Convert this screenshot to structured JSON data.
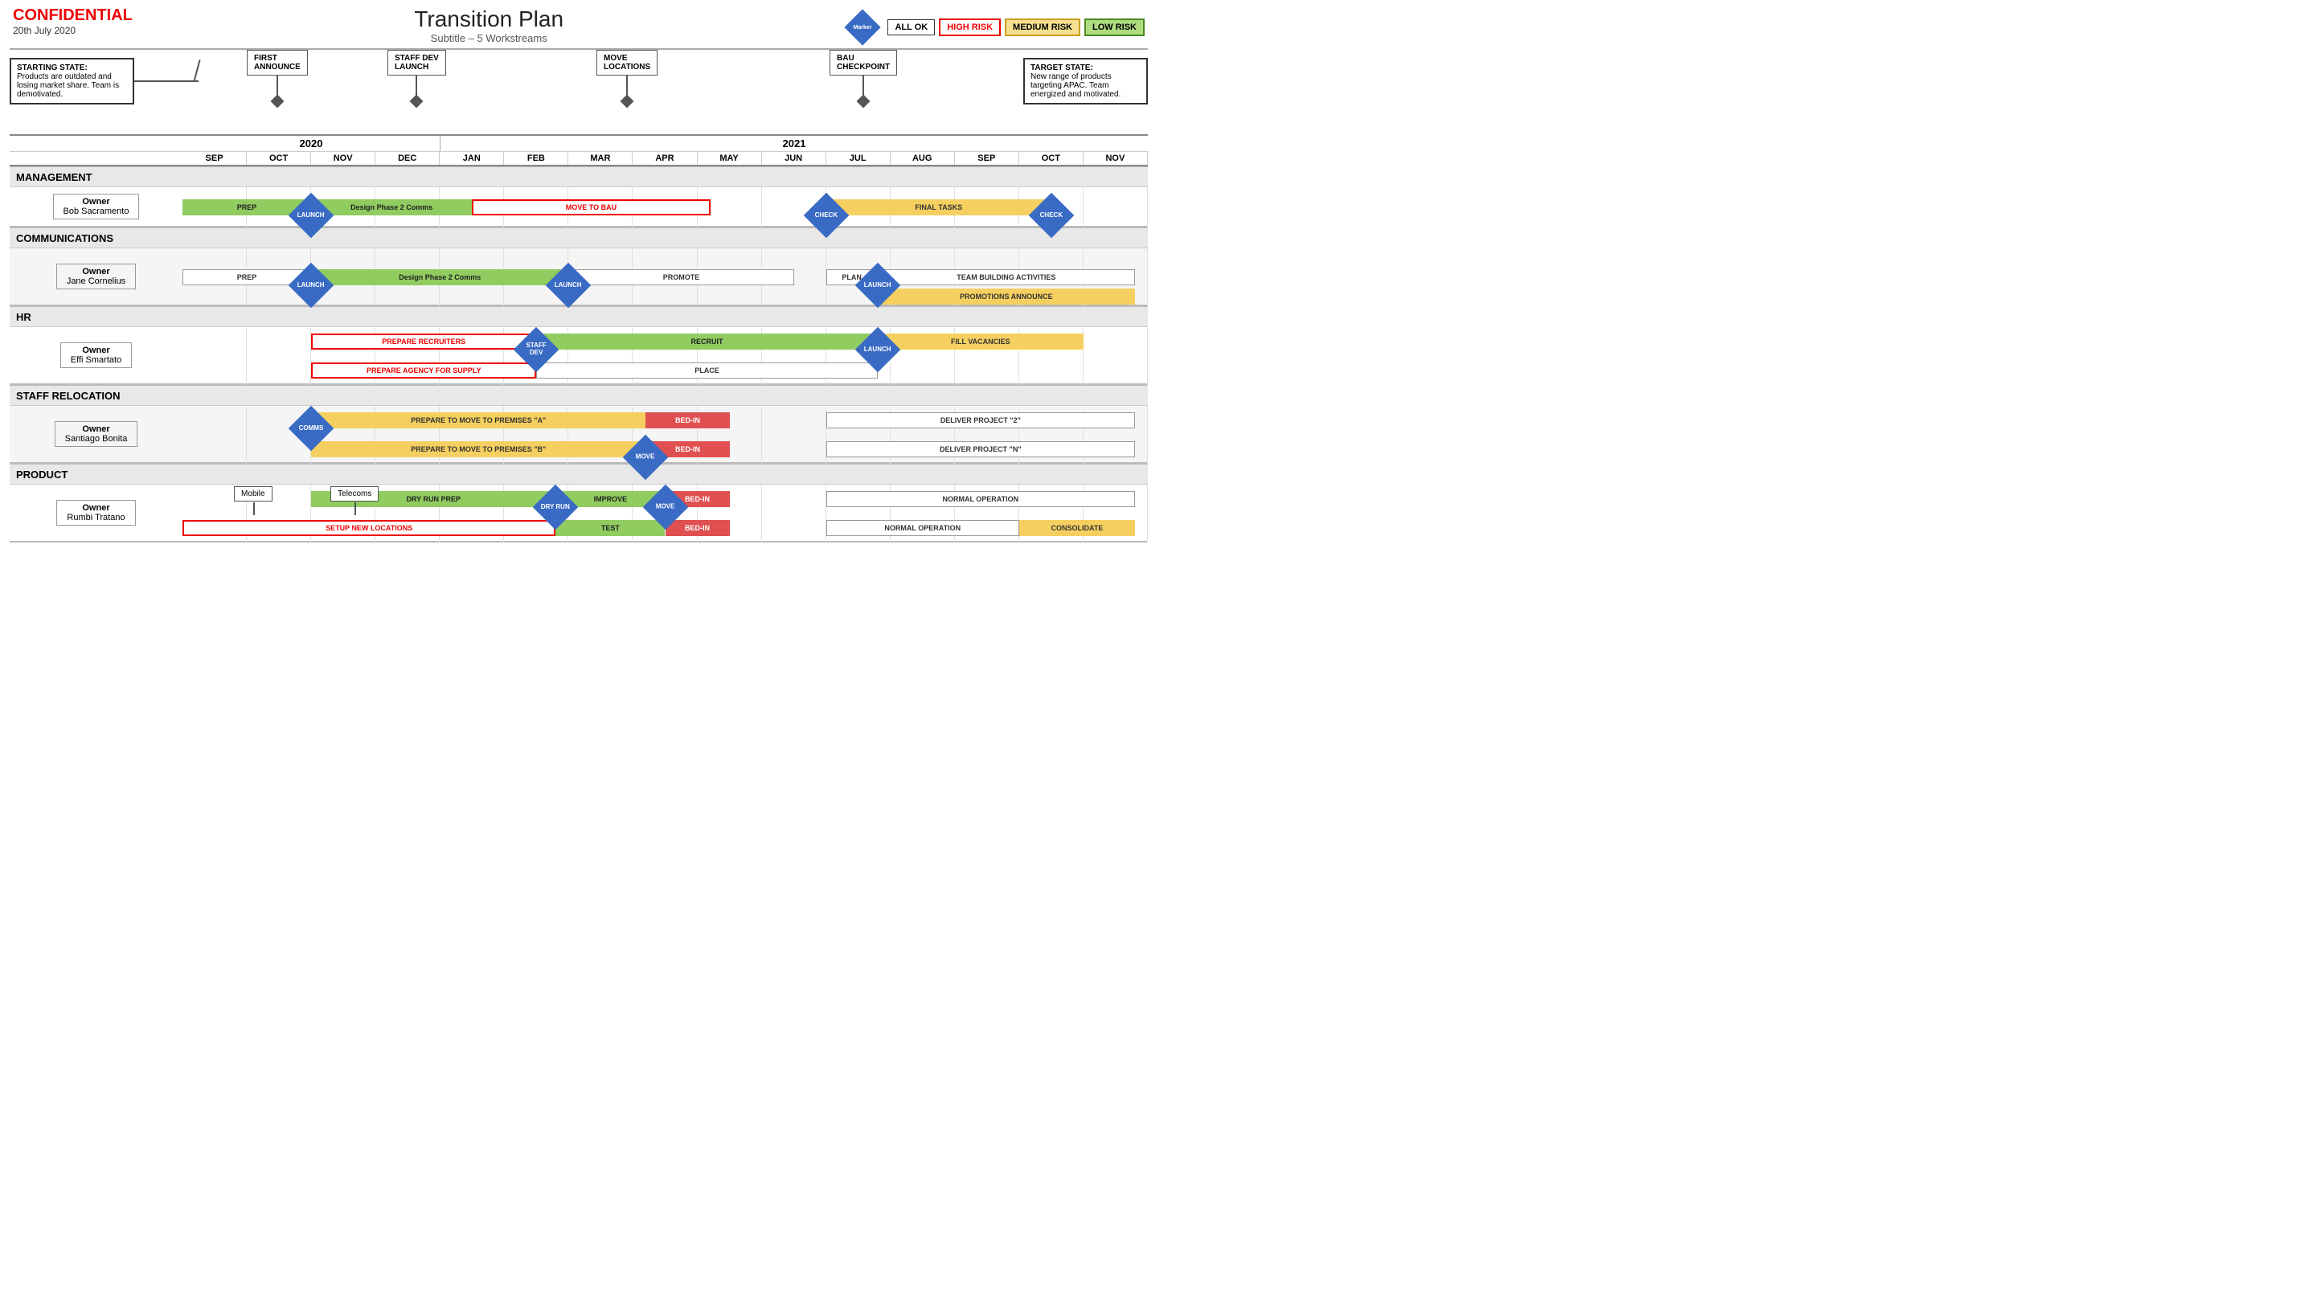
{
  "header": {
    "confidential": "CONFIDENTIAL",
    "date": "20th July 2020",
    "title": "Transition Plan",
    "subtitle": "Subtitle – 5 Workstreams",
    "legend": {
      "marker": "Marker",
      "allok": "ALL OK",
      "high": "HIGH RISK",
      "medium": "MEDIUM RISK",
      "low": "LOW RISK"
    }
  },
  "milestones": [
    {
      "id": "first-announce",
      "label": "FIRST ANNOUNCE",
      "col": 2.5
    },
    {
      "id": "staff-dev-launch",
      "label": "STAFF DEV LAUNCH",
      "col": 4.2
    },
    {
      "id": "move-locations",
      "label": "MOVE LOCATIONS",
      "col": 7.2
    },
    {
      "id": "bau-checkpoint",
      "label": "BAU CHECKPOINT",
      "col": 10.2
    }
  ],
  "starting_state": {
    "title": "STARTING STATE:",
    "body": "Products are outdated and losing market share. Team is demotivated."
  },
  "target_state": {
    "title": "TARGET STATE:",
    "body": "New range of products targeting APAC. Team energized and motivated."
  },
  "years": [
    {
      "label": "2020",
      "span": 4
    },
    {
      "label": "2021",
      "span": 11
    }
  ],
  "months": [
    "SEP",
    "OCT",
    "NOV",
    "DEC",
    "JAN",
    "FEB",
    "MAR",
    "APR",
    "MAY",
    "JUN",
    "JUL",
    "AUG",
    "SEP",
    "OCT",
    "NOV"
  ],
  "sections": [
    {
      "id": "management",
      "label": "MANAGEMENT",
      "owner": {
        "label": "Owner",
        "name": "Bob Sacramento"
      },
      "rows": [
        {
          "bars": [
            {
              "type": "green",
              "label": "PREP",
              "start": 0,
              "end": 2
            },
            {
              "type": "diamond",
              "label": "LAUNCH",
              "col": 2
            },
            {
              "type": "green",
              "label": "Design Phase 2 Comms",
              "start": 2,
              "end": 4.5
            },
            {
              "type": "red-outline",
              "label": "MOVE TO BAU",
              "start": 4.5,
              "end": 8.2
            },
            {
              "type": "diamond",
              "label": "CHECK",
              "col": 10
            },
            {
              "type": "yellow",
              "label": "FINAL TASKS",
              "start": 10,
              "end": 13.5
            },
            {
              "type": "diamond",
              "label": "CHECK",
              "col": 13.5
            }
          ]
        }
      ]
    },
    {
      "id": "communications",
      "label": "COMMUNICATIONS",
      "owner": {
        "label": "Owner",
        "name": "Jane Cornelius"
      },
      "rows": [
        {
          "bars": [
            {
              "type": "white",
              "label": "PREP",
              "start": 0,
              "end": 2
            },
            {
              "type": "diamond",
              "label": "LAUNCH",
              "col": 2
            },
            {
              "type": "green",
              "label": "Design Phase 2 Comms",
              "start": 2,
              "end": 6
            },
            {
              "type": "diamond",
              "label": "LAUNCH",
              "col": 6
            },
            {
              "type": "white",
              "label": "PROMOTE",
              "start": 6,
              "end": 9.5
            },
            {
              "type": "white",
              "label": "PLAN",
              "start": 10,
              "end": 10.8
            },
            {
              "type": "diamond",
              "label": "LAUNCH",
              "col": 10.8
            },
            {
              "type": "white",
              "label": "TEAM BUILDING ACTIVITIES",
              "start": 10.8,
              "end": 14.8
            },
            {
              "type": "yellow",
              "label": "PROMOTIONS ANNOUNCE",
              "start": 10.8,
              "end": 14.8,
              "row": 1
            }
          ]
        }
      ]
    },
    {
      "id": "hr",
      "label": "HR",
      "owner": {
        "label": "Owner",
        "name": "Effi Smartato"
      },
      "rows": [
        {
          "bars": [
            {
              "type": "red-outline",
              "label": "PREPARE RECRUITERS",
              "start": 2,
              "end": 5.5
            },
            {
              "type": "diamond",
              "label": "STAFF DEV",
              "col": 5.5
            },
            {
              "type": "green",
              "label": "RECRUIT",
              "start": 5.5,
              "end": 10.8
            },
            {
              "type": "diamond",
              "label": "LAUNCH",
              "col": 10.8
            },
            {
              "type": "yellow",
              "label": "FILL VACANCIES",
              "start": 10.8,
              "end": 14
            }
          ]
        },
        {
          "bars": [
            {
              "type": "red-outline",
              "label": "PREPARE AGENCY FOR SUPPLY",
              "start": 2,
              "end": 5.5
            },
            {
              "type": "white",
              "label": "PLACE",
              "start": 5.5,
              "end": 10.8
            }
          ]
        }
      ]
    },
    {
      "id": "staff-relocation",
      "label": "STAFF RELOCATION",
      "owner": {
        "label": "Owner",
        "name": "Santiago Bonita"
      },
      "rows": [
        {
          "bars": [
            {
              "type": "diamond",
              "label": "COMMS",
              "col": 2
            },
            {
              "type": "yellow",
              "label": "PREPARE TO MOVE TO PREMISES \"A\"",
              "start": 2,
              "end": 7.2
            },
            {
              "type": "red-fill",
              "label": "BED-IN",
              "start": 7.2,
              "end": 8.5
            },
            {
              "type": "white",
              "label": "DELIVER PROJECT \"2\"",
              "start": 10,
              "end": 14.8
            }
          ]
        },
        {
          "bars": [
            {
              "type": "diamond",
              "label": "MOVE",
              "col": 7.2
            },
            {
              "type": "yellow",
              "label": "PREPARE TO MOVE TO PREMISES \"B\"",
              "start": 2,
              "end": 7.2
            },
            {
              "type": "red-fill",
              "label": "BED-IN",
              "start": 7.2,
              "end": 8.5
            },
            {
              "type": "white",
              "label": "DELIVER PROJECT \"N\"",
              "start": 10,
              "end": 14.8
            }
          ]
        }
      ]
    },
    {
      "id": "product",
      "label": "PRODUCT",
      "owner": {
        "label": "Owner",
        "name": "Rumbi Tratano"
      },
      "rows": [
        {
          "bars": [
            {
              "type": "green",
              "label": "DRY RUN PREP",
              "start": 2,
              "end": 5.8
            },
            {
              "type": "diamond",
              "label": "DRY RUN",
              "col": 5.8
            },
            {
              "type": "green",
              "label": "IMPROVE",
              "start": 5.8,
              "end": 7.5
            },
            {
              "type": "diamond",
              "label": "MOVE",
              "col": 7.5
            },
            {
              "type": "red-fill",
              "label": "BED-IN",
              "start": 7.5,
              "end": 8.5
            },
            {
              "type": "white",
              "label": "NORMAL OPERATION",
              "start": 10,
              "end": 14.8
            }
          ]
        },
        {
          "bars": [
            {
              "type": "red-outline",
              "label": "SETUP NEW LOCATIONS",
              "start": 0,
              "end": 5.8
            },
            {
              "type": "green",
              "label": "TEST",
              "start": 5.8,
              "end": 7.5
            },
            {
              "type": "red-fill",
              "label": "BED-IN",
              "start": 7.5,
              "end": 8.5
            },
            {
              "type": "white",
              "label": "NORMAL OPERATION",
              "start": 10,
              "end": 13
            },
            {
              "type": "yellow",
              "label": "CONSOLIDATE",
              "start": 13,
              "end": 14.8
            }
          ]
        }
      ]
    }
  ]
}
